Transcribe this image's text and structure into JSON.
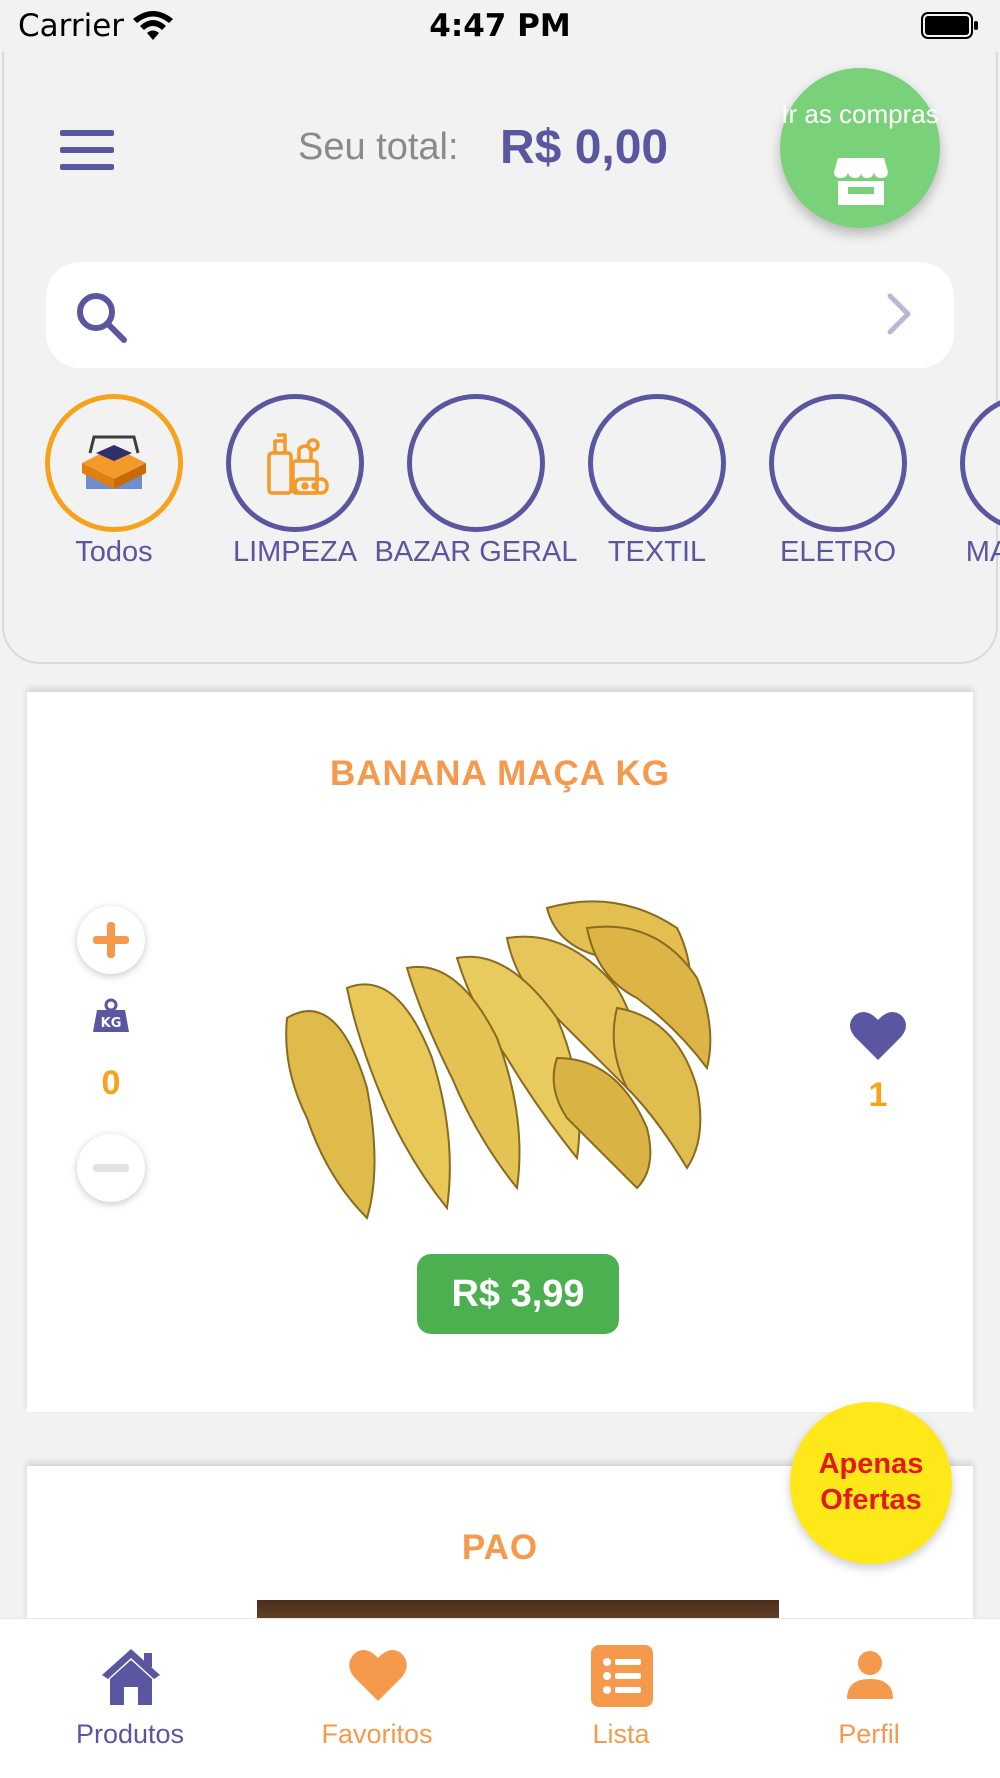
{
  "status_bar": {
    "carrier": "Carrier",
    "time": "4:47 PM"
  },
  "header": {
    "total_label": "Seu total:",
    "total_value": "R$  0,00",
    "go_shopping_label": "Ir as compras"
  },
  "search": {
    "placeholder": ""
  },
  "categories": [
    {
      "label": "Todos",
      "active": true,
      "icon": "box-stack-icon"
    },
    {
      "label": "LIMPEZA",
      "active": false,
      "icon": "cleaning-supplies-icon"
    },
    {
      "label": "BAZAR GERAL",
      "active": false,
      "icon": ""
    },
    {
      "label": "TEXTIL",
      "active": false,
      "icon": ""
    },
    {
      "label": "ELETRO",
      "active": false,
      "icon": ""
    },
    {
      "label": "MA PA",
      "active": false,
      "icon": ""
    }
  ],
  "products": [
    {
      "title": "BANANA MAÇA KG",
      "unit_icon": "kg-icon",
      "quantity": "0",
      "favorite_count": "1",
      "price": "R$  3,99"
    },
    {
      "title": "PAO"
    }
  ],
  "offers_button": {
    "label": "Apenas Ofertas"
  },
  "tab_bar": {
    "items": [
      {
        "label": "Produtos",
        "icon": "home-icon",
        "active": true
      },
      {
        "label": "Favoritos",
        "icon": "heart-icon",
        "active": false
      },
      {
        "label": "Lista",
        "icon": "list-icon",
        "active": false
      },
      {
        "label": "Perfil",
        "icon": "person-icon",
        "active": false
      }
    ]
  },
  "colors": {
    "primary": "#5b56a0",
    "accent_orange": "#f59a4c",
    "active_category": "#f6a21b",
    "go_shopping": "#79d17a",
    "price_badge": "#4caf50",
    "offers_bg": "#ffe81a",
    "offers_text": "#e21a1a"
  }
}
